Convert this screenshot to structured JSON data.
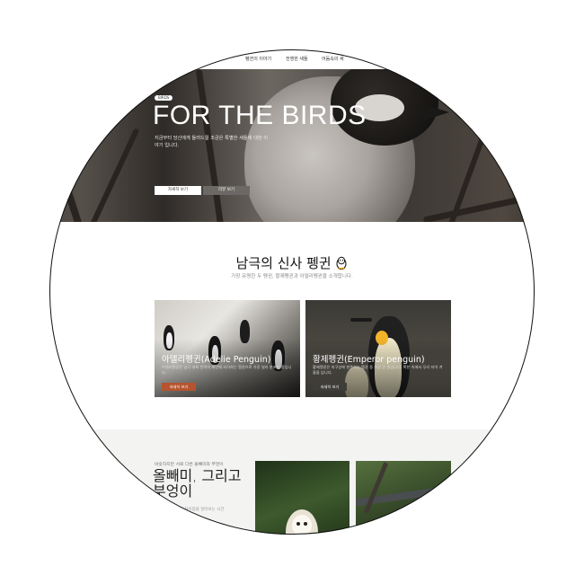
{
  "nav": {
    "items": [
      "펭귄의 이야기",
      "전쟁한 새들",
      "어둠속의 새"
    ]
  },
  "hero": {
    "badge": "BIRDS",
    "title": "FOR THE BIRDS",
    "description": "지금부터 당신에게 들려드릴 조금은 특별한 새들에 대한 이야기 입니다.",
    "primary_button": "자세히 보기",
    "secondary_button": "리뷰 보기",
    "slide_dots": 4,
    "active_slide": 4
  },
  "penguins": {
    "title": "남극의 신사 펭귄",
    "title_icon": "penguin-icon",
    "subtitle": "가장 유명한 두 펭귄, 황제펭귄과 아델리펭귄을 소개합니다.",
    "cards": [
      {
        "title": "아델리펭귄(Adelie Penguin)",
        "description": "아델리펭귄은 남극 대륙 전역의 해안에 서식하는 펭귄으로 가장 널리 분포한 종입니다.",
        "button": "자세히 보기"
      },
      {
        "title": "황제펭귄(Emperor penguin)",
        "description": "황제펭귄은 지구상에 현존하는 펭귄 중 가장 큰 종입니다. 혹한 속에서 무리 지어 겨울을 납니다.",
        "button": "자세히 보기"
      }
    ]
  },
  "owls": {
    "eyebrow": "비슷하지만 서로 다른 올빼미와 부엉이",
    "title": "올빼미, 그리고 부엉이",
    "description": "밤의 제왕인 둘의 차이점을 알아보는 시간"
  },
  "colors": {
    "accent_button": "#b5542f",
    "dark_button": "#6b6865"
  }
}
